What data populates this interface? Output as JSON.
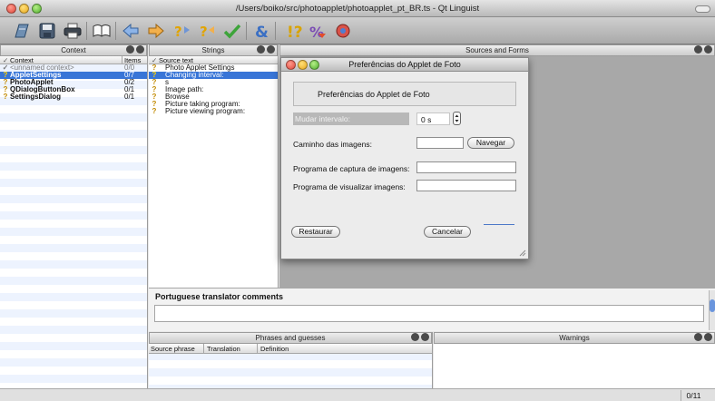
{
  "window": {
    "title": "/Users/boiko/src/photoapplet/photoapplet_pt_BR.ts - Qt Linguist"
  },
  "toolbar": {
    "icons": [
      "open-icon",
      "save-icon",
      "print-icon",
      "phrasebook-icon",
      "prev-icon",
      "next-icon",
      "prev-unfinished-icon",
      "next-unfinished-icon",
      "done-next-icon",
      "accelerators-icon",
      "ending-punctuation-icon",
      "phrase-matches-icon",
      "place-markers-icon"
    ]
  },
  "context": {
    "title": "Context",
    "col_context": "Context",
    "col_items": "Items",
    "rows": [
      {
        "name": "<unnamed context>",
        "items": "0/0",
        "icon": "✓",
        "state": "unnamed"
      },
      {
        "name": "AppletSettings",
        "items": "0/7",
        "icon": "?",
        "state": "selected"
      },
      {
        "name": "PhotoApplet",
        "items": "0/2",
        "icon": "?",
        "state": "normal"
      },
      {
        "name": "QDialogButtonBox",
        "items": "0/1",
        "icon": "?",
        "state": "normal"
      },
      {
        "name": "SettingsDialog",
        "items": "0/1",
        "icon": "?",
        "state": "normal"
      }
    ]
  },
  "strings": {
    "title": "Strings",
    "col_source": "Source text",
    "rows": [
      {
        "text": "Photo Applet Settings",
        "icon": "?",
        "state": "normal"
      },
      {
        "text": "Changing interval:",
        "icon": "?",
        "state": "selected"
      },
      {
        "text": "s",
        "icon": "?",
        "state": "normal"
      },
      {
        "text": "Image path:",
        "icon": "?",
        "state": "normal"
      },
      {
        "text": "Browse",
        "icon": "?",
        "state": "normal"
      },
      {
        "text": "Picture taking program:",
        "icon": "?",
        "state": "normal"
      },
      {
        "text": "Picture viewing program:",
        "icon": "?",
        "state": "normal"
      }
    ]
  },
  "sources": {
    "title": "Sources and Forms"
  },
  "dialog": {
    "title": "Preferências do Applet de Foto",
    "header": "Preferências do Applet de Foto",
    "interval_label": "Mudar intervalo:",
    "interval_value": "0 s",
    "path_label": "Caminho das imagens:",
    "path_value": "",
    "browse": "Navegar",
    "capture_label": "Programa de captura de imagens:",
    "capture_value": "",
    "view_label": "Programa de visualizar imagens:",
    "view_value": "",
    "reset": "Restaurar",
    "cancel": "Cancelar"
  },
  "comments": {
    "title": "Portuguese translator comments",
    "value": ""
  },
  "phrases": {
    "title": "Phrases and guesses",
    "col_source": "Source phrase",
    "col_translation": "Translation",
    "col_definition": "Definition"
  },
  "warnings": {
    "title": "Warnings"
  },
  "status": {
    "count": "0/11"
  }
}
